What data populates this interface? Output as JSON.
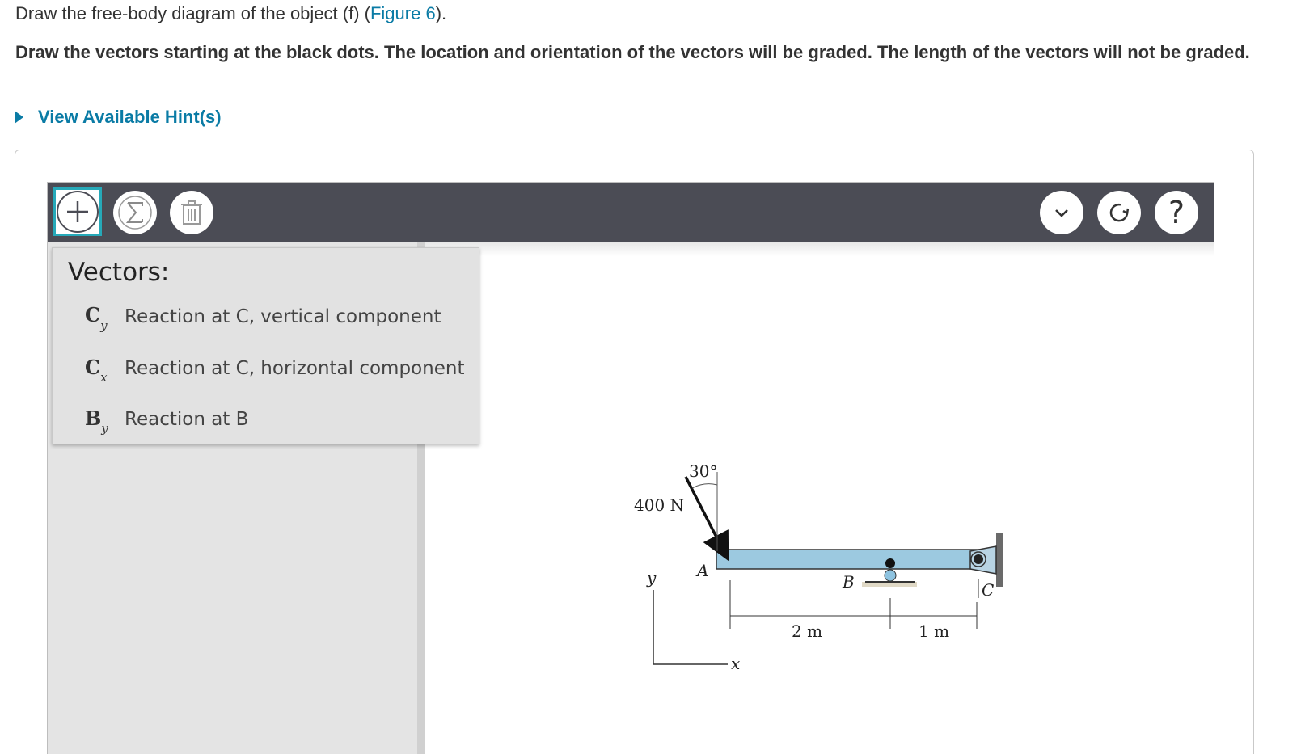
{
  "intro": {
    "text": "Draw the free-body diagram of the object (f) (",
    "link": "Figure 6",
    "tail": ")."
  },
  "instructions": "Draw the vectors starting at the black dots. The location and orientation of the vectors will be graded. The length of the vectors will not be graded.",
  "hint_link": "View Available Hint(s)",
  "toolbar": {
    "left_icons": [
      "add-icon",
      "sigma-icon",
      "trash-icon"
    ],
    "right_icons": [
      "chevron-down-icon",
      "reset-icon",
      "help-icon"
    ],
    "help_glyph": "?",
    "sigma_glyph": "Σ"
  },
  "vectors_menu": {
    "title": "Vectors:",
    "items": [
      {
        "symbol": "C",
        "sub": "y",
        "label": "Reaction at C, vertical component"
      },
      {
        "symbol": "C",
        "sub": "x",
        "label": "Reaction at C, horizontal component"
      },
      {
        "symbol": "B",
        "sub": "y",
        "label": "Reaction at B"
      }
    ]
  },
  "figure": {
    "force_label": "400 N",
    "angle_label": "30°",
    "point_a": "A",
    "point_b": "B",
    "point_c": "C",
    "dim_ab": "2 m",
    "dim_bc": "1 m",
    "axis_y": "y",
    "axis_x": "x"
  },
  "colors": {
    "accent": "#0a7ba5",
    "toolbar": "#4b4c55",
    "selected_outline": "#26a9b9",
    "beam": "#9cc9e0"
  }
}
